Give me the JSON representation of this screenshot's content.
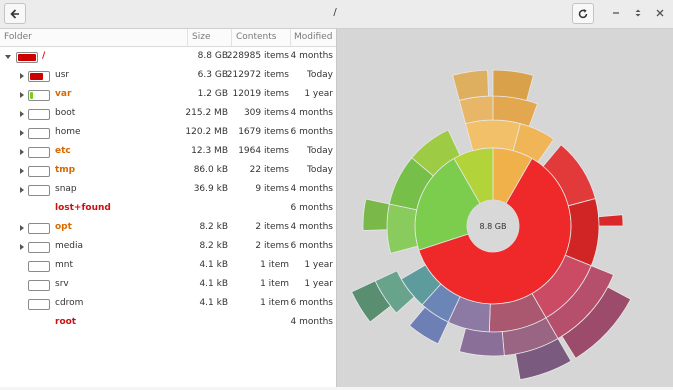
{
  "window": {
    "title": "/"
  },
  "headers": {
    "folder": "Folder",
    "size": "Size",
    "contents": "Contents",
    "modified": "Modified"
  },
  "rows": [
    {
      "name": "/",
      "size": "8.8 GB",
      "contents": "228985 items",
      "modified": "4 months",
      "level": 0,
      "expander": "down",
      "box": true,
      "fill_color": "#cc0000",
      "fill_fraction": 1.0,
      "name_style": "red"
    },
    {
      "name": "usr",
      "size": "6.3 GB",
      "contents": "212972 items",
      "modified": "Today",
      "level": 1,
      "expander": "right",
      "box": true,
      "fill_color": "#cc0000",
      "fill_fraction": 0.72,
      "name_style": "normal"
    },
    {
      "name": "var",
      "size": "1.2 GB",
      "contents": "12019 items",
      "modified": "1 year",
      "level": 1,
      "expander": "right",
      "box": true,
      "fill_color": "#73d216",
      "fill_fraction": 0.14,
      "name_style": "orange"
    },
    {
      "name": "boot",
      "size": "215.2 MB",
      "contents": "309 items",
      "modified": "4 months",
      "level": 1,
      "expander": "right",
      "box": true,
      "fill_color": "#cccccc",
      "fill_fraction": 0,
      "name_style": "normal"
    },
    {
      "name": "home",
      "size": "120.2 MB",
      "contents": "1679 items",
      "modified": "6 months",
      "level": 1,
      "expander": "right",
      "box": true,
      "fill_color": "#cccccc",
      "fill_fraction": 0,
      "name_style": "normal"
    },
    {
      "name": "etc",
      "size": "12.3 MB",
      "contents": "1964 items",
      "modified": "Today",
      "level": 1,
      "expander": "right",
      "box": true,
      "fill_color": "#cccccc",
      "fill_fraction": 0,
      "name_style": "orange"
    },
    {
      "name": "tmp",
      "size": "86.0 kB",
      "contents": "22 items",
      "modified": "Today",
      "level": 1,
      "expander": "right",
      "box": true,
      "fill_color": "#cccccc",
      "fill_fraction": 0,
      "name_style": "orange"
    },
    {
      "name": "snap",
      "size": "36.9 kB",
      "contents": "9 items",
      "modified": "4 months",
      "level": 1,
      "expander": "right",
      "box": true,
      "fill_color": "#cccccc",
      "fill_fraction": 0,
      "name_style": "normal"
    },
    {
      "name": "lost+found",
      "size": "",
      "contents": "",
      "modified": "6 months",
      "level": 1,
      "expander": "none",
      "box": false,
      "fill_color": "",
      "fill_fraction": 0,
      "name_style": "red"
    },
    {
      "name": "opt",
      "size": "8.2 kB",
      "contents": "2 items",
      "modified": "4 months",
      "level": 1,
      "expander": "right",
      "box": true,
      "fill_color": "#cccccc",
      "fill_fraction": 0,
      "name_style": "orange"
    },
    {
      "name": "media",
      "size": "8.2 kB",
      "contents": "2 items",
      "modified": "6 months",
      "level": 1,
      "expander": "right",
      "box": true,
      "fill_color": "#cccccc",
      "fill_fraction": 0,
      "name_style": "normal"
    },
    {
      "name": "mnt",
      "size": "4.1 kB",
      "contents": "1 item",
      "modified": "1 year",
      "level": 1,
      "expander": "none",
      "box": true,
      "fill_color": "#cccccc",
      "fill_fraction": 0,
      "name_style": "normal"
    },
    {
      "name": "srv",
      "size": "4.1 kB",
      "contents": "1 item",
      "modified": "1 year",
      "level": 1,
      "expander": "none",
      "box": true,
      "fill_color": "#cccccc",
      "fill_fraction": 0,
      "name_style": "normal"
    },
    {
      "name": "cdrom",
      "size": "4.1 kB",
      "contents": "1 item",
      "modified": "6 months",
      "level": 1,
      "expander": "none",
      "box": true,
      "fill_color": "#cccccc",
      "fill_fraction": 0,
      "name_style": "normal"
    },
    {
      "name": "root",
      "size": "",
      "contents": "",
      "modified": "4 months",
      "level": 1,
      "expander": "none",
      "box": false,
      "fill_color": "",
      "fill_fraction": 0,
      "name_style": "red"
    }
  ],
  "chart": {
    "center_label": "8.8 GB"
  },
  "icons": {
    "back": "back-arrow-icon",
    "reload": "reload-icon",
    "minimize": "minimize-icon",
    "maximize": "maximize-icon",
    "close": "close-icon"
  }
}
